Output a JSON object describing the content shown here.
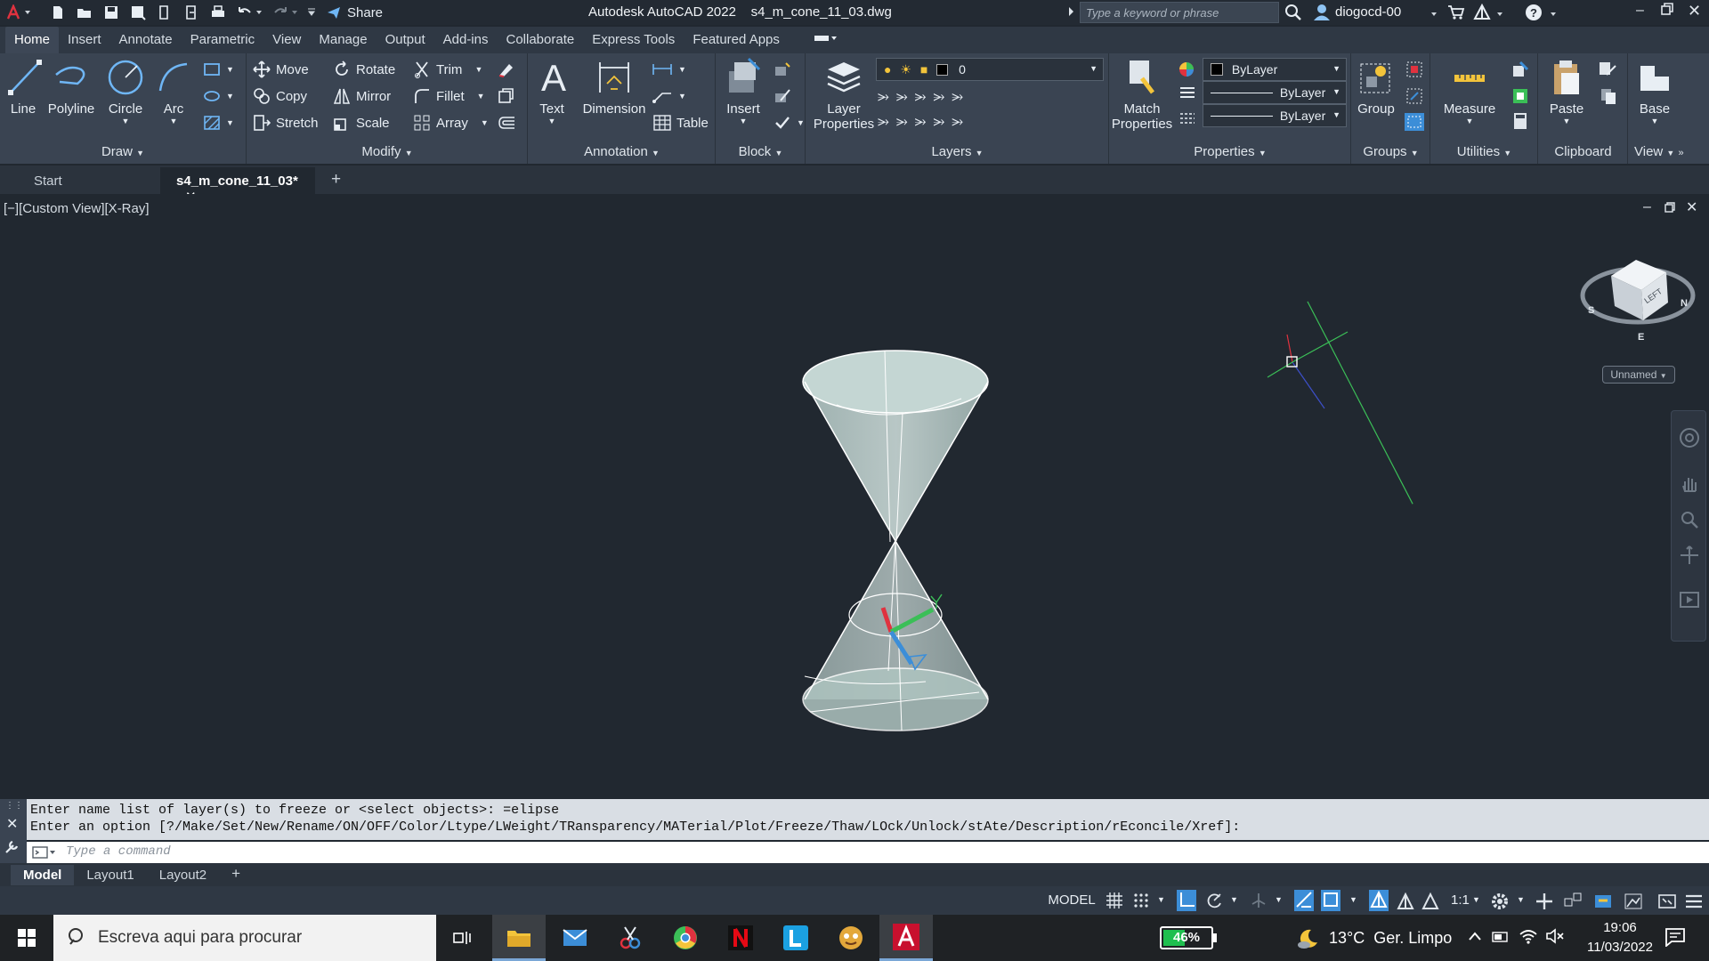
{
  "titlebar": {
    "title": "Autodesk AutoCAD 2022    s4_m_cone_11_03.dwg",
    "share_label": "Share",
    "search_placeholder": "Type a keyword or phrase",
    "username": "diogocd-00"
  },
  "ribbon_tabs": [
    "Home",
    "Insert",
    "Annotate",
    "Parametric",
    "View",
    "Manage",
    "Output",
    "Add-ins",
    "Collaborate",
    "Express Tools",
    "Featured Apps"
  ],
  "ribbon": {
    "draw": {
      "title": "Draw",
      "line": "Line",
      "polyline": "Polyline",
      "circle": "Circle",
      "arc": "Arc"
    },
    "modify": {
      "title": "Modify",
      "move": "Move",
      "rotate": "Rotate",
      "trim": "Trim",
      "copy": "Copy",
      "mirror": "Mirror",
      "fillet": "Fillet",
      "stretch": "Stretch",
      "scale": "Scale",
      "array": "Array"
    },
    "annotation": {
      "title": "Annotation",
      "text": "Text",
      "dimension": "Dimension",
      "table": "Table"
    },
    "block": {
      "title": "Block",
      "insert": "Insert"
    },
    "layers": {
      "title": "Layers",
      "layer_properties_l1": "Layer",
      "layer_properties_l2": "Properties",
      "current_layer": "0"
    },
    "properties": {
      "title": "Properties",
      "match_l1": "Match",
      "match_l2": "Properties",
      "color": "ByLayer",
      "linetype": "ByLayer",
      "lineweight": "ByLayer"
    },
    "groups": {
      "title": "Groups",
      "group": "Group"
    },
    "utilities": {
      "title": "Utilities",
      "measure": "Measure"
    },
    "clipboard": {
      "title": "Clipboard",
      "paste": "Paste"
    },
    "view": {
      "title": "View",
      "base": "Base"
    }
  },
  "doc_tabs": {
    "start": "Start",
    "active": "s4_m_cone_11_03*"
  },
  "viewport": {
    "label": "[−][Custom View][X-Ray]",
    "viewcube_face": "LEFT",
    "compass_s": "S",
    "compass_e": "E",
    "compass_n": "N",
    "named_view": "Unnamed",
    "ucs_y": "Y"
  },
  "command": {
    "history_1": "Enter name list of layer(s) to freeze or <select objects>: =elipse",
    "history_2": "Enter an option [?/Make/Set/New/Rename/ON/OFF/Color/Ltype/LWeight/TRansparency/MATerial/Plot/Freeze/Thaw/LOck/Unlock/stAte/Description/rEconcile/Xref]:",
    "placeholder": "Type a command"
  },
  "layout_tabs": [
    "Model",
    "Layout1",
    "Layout2"
  ],
  "statusbar": {
    "model": "MODEL",
    "scale": "1:1"
  },
  "taskbar": {
    "search_placeholder": "Escreva aqui para procurar",
    "battery_percent": "46%",
    "battery_level": 0.46,
    "weather": "13°C  Ger. Limpo",
    "time": "19:06",
    "date": "11/03/2022"
  },
  "colors": {
    "accent": "#3c8ed8",
    "cone_fill": "#c9dcd9",
    "autocad_red": "#c8102e"
  }
}
